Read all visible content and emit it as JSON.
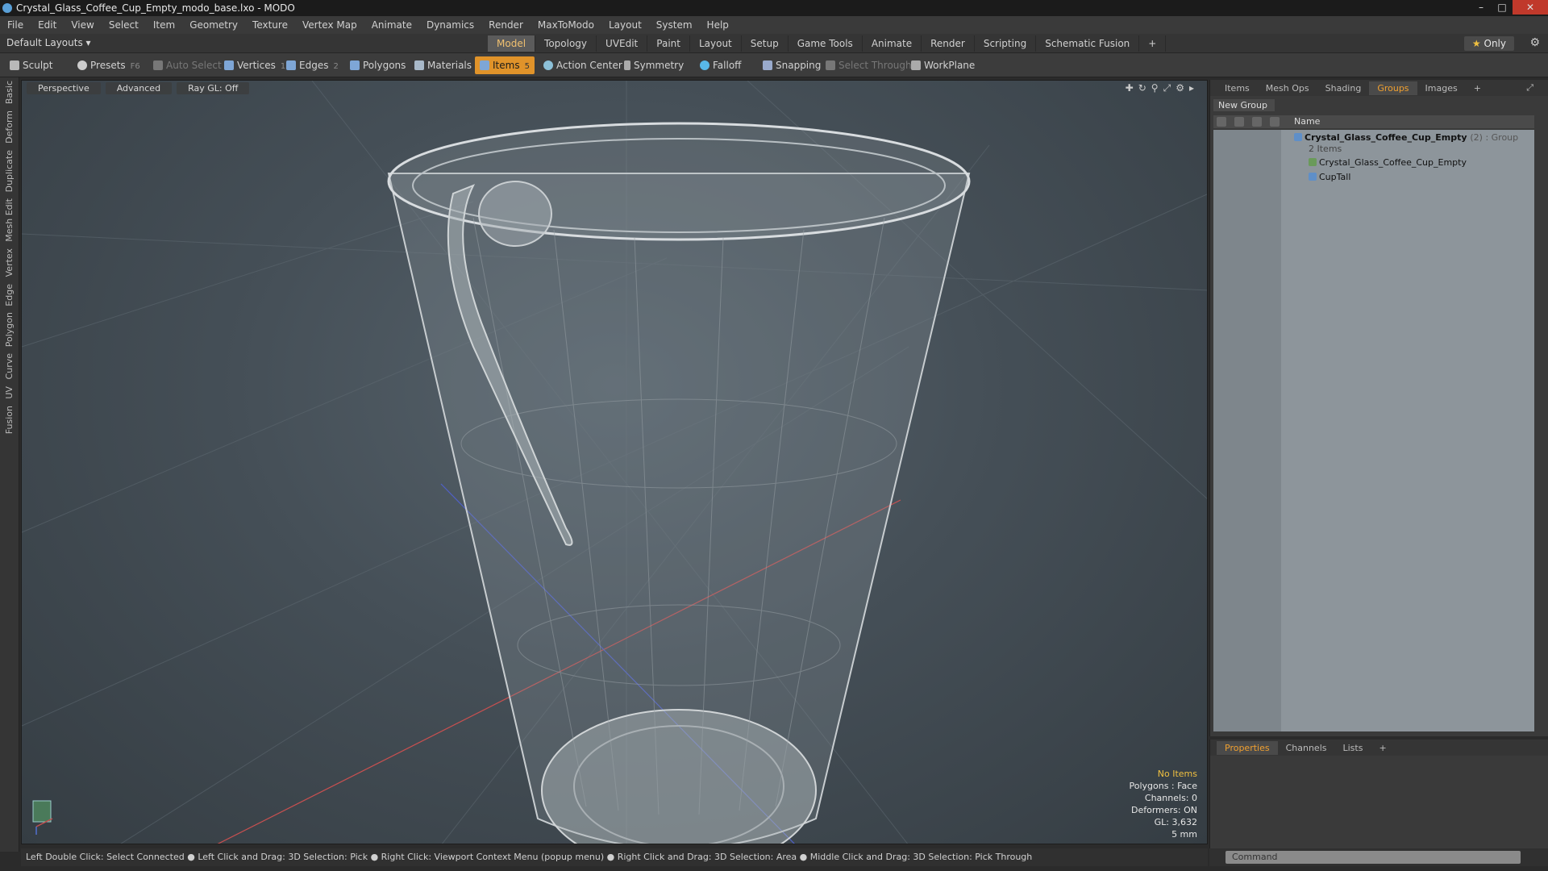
{
  "window": {
    "title": "Crystal_Glass_Coffee_Cup_Empty_modo_base.lxo - MODO"
  },
  "menu": [
    "File",
    "Edit",
    "View",
    "Select",
    "Item",
    "Geometry",
    "Texture",
    "Vertex Map",
    "Animate",
    "Dynamics",
    "Render",
    "MaxToModo",
    "Layout",
    "System",
    "Help"
  ],
  "layout_dropdown": "Default Layouts",
  "mode_tabs": {
    "items": [
      "Model",
      "Topology",
      "UVEdit",
      "Paint",
      "Layout",
      "Setup",
      "Game Tools",
      "Animate",
      "Render",
      "Scripting",
      "Schematic Fusion"
    ],
    "active": "Model"
  },
  "only_label": "Only",
  "toolbar": {
    "sculpt": "Sculpt",
    "presets": "Presets",
    "presets_key": "F6",
    "auto_select": "Auto Select",
    "vertices": "Vertices",
    "vertices_count": "1",
    "edges": "Edges",
    "edges_count": "2",
    "polygons": "Polygons",
    "materials": "Materials",
    "items": "Items",
    "items_count": "5",
    "action_center": "Action Center",
    "symmetry": "Symmetry",
    "falloff": "Falloff",
    "snapping": "Snapping",
    "select_through": "Select Through",
    "workplane": "WorkPlane"
  },
  "left_tabs": [
    "Basic",
    "Deform",
    "Duplicate",
    "Mesh Edit",
    "Vertex",
    "Edge",
    "Polygon",
    "Curve",
    "UV",
    "Fusion"
  ],
  "viewport": {
    "perspective": "Perspective",
    "advanced": "Advanced",
    "raygl": "Ray GL: Off",
    "info": {
      "no_items": "No Items",
      "polygons": "Polygons : Face",
      "channels": "Channels: 0",
      "deformers": "Deformers: ON",
      "gl": "GL: 3,632",
      "unit": "5 mm"
    }
  },
  "status_text": "Left Double Click: Select Connected ● Left Click and Drag: 3D Selection: Pick ● Right Click: Viewport Context Menu (popup menu) ● Right Click and Drag: 3D Selection: Area ● Middle Click and Drag: 3D Selection: Pick Through",
  "right_panel": {
    "tabs": [
      "Items",
      "Mesh Ops",
      "Shading",
      "Groups",
      "Images"
    ],
    "active_tab": "Groups",
    "new_group": "New Group",
    "column_name": "Name",
    "tree": {
      "group_name": "Crystal_Glass_Coffee_Cup_Empty",
      "group_meta": "(2) : Group",
      "group_sub": "2 Items",
      "child1": "Crystal_Glass_Coffee_Cup_Empty",
      "child2": "CupTall"
    }
  },
  "props_panel": {
    "tabs": [
      "Properties",
      "Channels",
      "Lists"
    ],
    "active_tab": "Properties"
  },
  "command_placeholder": "Command",
  "colors": {
    "accent": "#e0932a",
    "active_tab_text": "#f0a030",
    "viewport_bg": "#454f57"
  }
}
